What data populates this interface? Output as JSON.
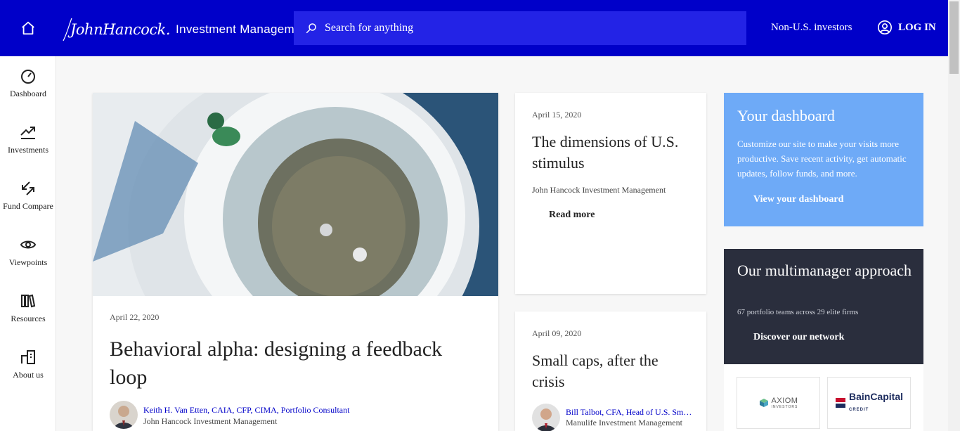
{
  "header": {
    "logo_script": "JohnHancock.",
    "logo_suffix": "Investment Management",
    "search_placeholder": "Search for anything",
    "non_us": "Non-U.S. investors",
    "login": "LOG IN"
  },
  "sidebar": {
    "items": [
      {
        "label": "Dashboard",
        "icon": "gauge-icon"
      },
      {
        "label": "Investments",
        "icon": "trend-up-icon"
      },
      {
        "label": "Fund Compare",
        "icon": "compare-arrows-icon"
      },
      {
        "label": "Viewpoints",
        "icon": "eye-icon"
      },
      {
        "label": "Resources",
        "icon": "books-icon"
      },
      {
        "label": "About us",
        "icon": "building-icon"
      }
    ]
  },
  "hero": {
    "date": "April 22, 2020",
    "title": "Behavioral alpha: designing a feedback loop",
    "author": "Keith H. Van Etten, CAIA, CFP, CIMA, Portfolio Consultant",
    "org": "John Hancock Investment Management"
  },
  "cards": [
    {
      "date": "April 15, 2020",
      "title": "The dimensions of U.S. stimulus",
      "org": "John Hancock Investment Management",
      "more": "Read more"
    },
    {
      "date": "April 09, 2020",
      "title": "Small caps, after the crisis",
      "author": "Bill Talbot, CFA, Head of U.S. Small Cap Equity",
      "org": "Manulife Investment Management"
    }
  ],
  "dashboard": {
    "heading": "Your dashboard",
    "body": "Customize our site to make your visits more productive. Save recent activity, get automatic updates, follow funds, and more.",
    "cta": "View your dashboard"
  },
  "multimanager": {
    "heading": "Our multimanager approach",
    "sub": "67 portfolio teams across 29 elite firms",
    "cta": "Discover our network",
    "partners": [
      {
        "name": "AXIOM",
        "tag": "INVESTORS"
      },
      {
        "name": "BainCapital",
        "tag": "CREDIT"
      }
    ]
  },
  "colors": {
    "brand_blue": "#0000c9",
    "search_blue": "#2323e6",
    "dashboard_blue": "#6eaaf7",
    "dark_panel": "#2a2e3d"
  }
}
